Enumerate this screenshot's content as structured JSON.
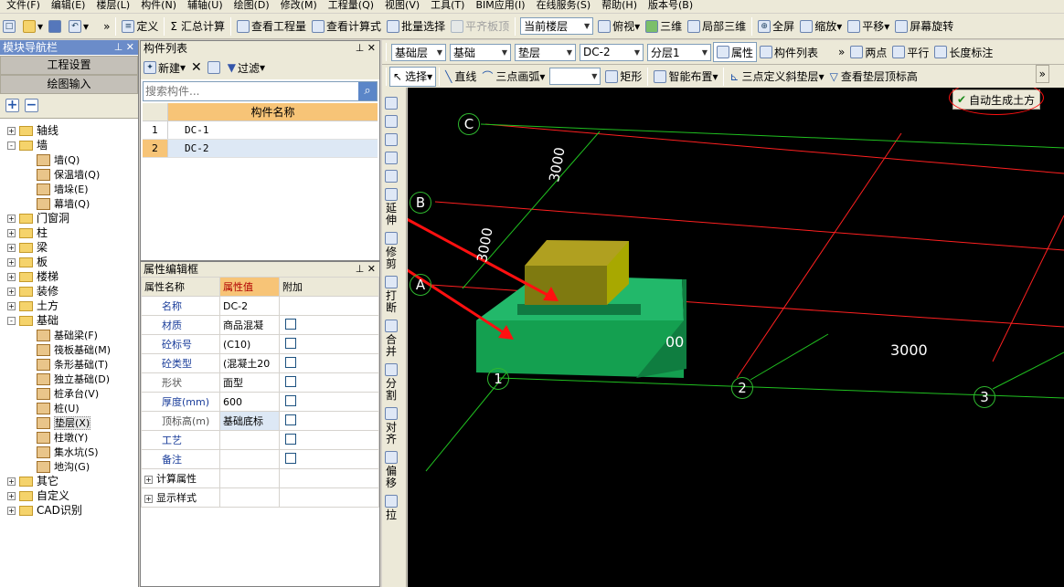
{
  "menu": [
    "文件(F)",
    "编辑(E)",
    "楼层(L)",
    "构件(N)",
    "辅轴(U)",
    "绘图(D)",
    "修改(M)",
    "工程量(Q)",
    "视图(V)",
    "工具(T)",
    "BIM应用(I)",
    "在线服务(S)",
    "帮助(H)",
    "版本号(B)"
  ],
  "toolbar1": {
    "more_left": "»",
    "define": "定义",
    "sum_calc": "汇总计算",
    "view_qty": "查看工程量",
    "view_formula": "查看计算式",
    "batch_select": "批量选择",
    "align_slab": "平齐板顶",
    "floor_select": "当前楼层",
    "top_view": "俯视",
    "three_d": "三维",
    "partial_3d": "局部三维",
    "full_screen": "全屏",
    "zoom": "缩放",
    "pan": "平移",
    "screen_rotate": "屏幕旋转"
  },
  "nav": {
    "title": "模块导航栏",
    "project_settings": "工程设置",
    "drawing_input": "绘图输入",
    "tree": [
      {
        "label": "轴线",
        "level": 0,
        "type": "folder",
        "exp": "+"
      },
      {
        "label": "墙",
        "level": 0,
        "type": "folder",
        "exp": "-"
      },
      {
        "label": "墙(Q)",
        "level": 1,
        "type": "leaf"
      },
      {
        "label": "保温墙(Q)",
        "level": 1,
        "type": "leaf"
      },
      {
        "label": "墙垛(E)",
        "level": 1,
        "type": "leaf"
      },
      {
        "label": "幕墙(Q)",
        "level": 1,
        "type": "leaf"
      },
      {
        "label": "门窗洞",
        "level": 0,
        "type": "folder",
        "exp": "+"
      },
      {
        "label": "柱",
        "level": 0,
        "type": "folder",
        "exp": "+"
      },
      {
        "label": "梁",
        "level": 0,
        "type": "folder",
        "exp": "+"
      },
      {
        "label": "板",
        "level": 0,
        "type": "folder",
        "exp": "+"
      },
      {
        "label": "楼梯",
        "level": 0,
        "type": "folder",
        "exp": "+"
      },
      {
        "label": "装修",
        "level": 0,
        "type": "folder",
        "exp": "+"
      },
      {
        "label": "土方",
        "level": 0,
        "type": "folder",
        "exp": "+"
      },
      {
        "label": "基础",
        "level": 0,
        "type": "folder",
        "exp": "-"
      },
      {
        "label": "基础梁(F)",
        "level": 1,
        "type": "leaf"
      },
      {
        "label": "筏板基础(M)",
        "level": 1,
        "type": "leaf"
      },
      {
        "label": "条形基础(T)",
        "level": 1,
        "type": "leaf"
      },
      {
        "label": "独立基础(D)",
        "level": 1,
        "type": "leaf"
      },
      {
        "label": "桩承台(V)",
        "level": 1,
        "type": "leaf"
      },
      {
        "label": "桩(U)",
        "level": 1,
        "type": "leaf"
      },
      {
        "label": "垫层(X)",
        "level": 1,
        "type": "leaf",
        "selected": true
      },
      {
        "label": "柱墩(Y)",
        "level": 1,
        "type": "leaf"
      },
      {
        "label": "集水坑(S)",
        "level": 1,
        "type": "leaf"
      },
      {
        "label": "地沟(G)",
        "level": 1,
        "type": "leaf"
      },
      {
        "label": "其它",
        "level": 0,
        "type": "folder",
        "exp": "+"
      },
      {
        "label": "自定义",
        "level": 0,
        "type": "folder",
        "exp": "+"
      },
      {
        "label": "CAD识别",
        "level": 0,
        "type": "folder",
        "exp": "+"
      }
    ]
  },
  "component_list": {
    "title": "构件列表",
    "new_btn": "新建",
    "filter_btn": "过滤",
    "search_placeholder": "搜索构件...",
    "col_name": "构件名称",
    "rows": [
      {
        "idx": "1",
        "name": "DC-1"
      },
      {
        "idx": "2",
        "name": "DC-2"
      }
    ]
  },
  "property_panel": {
    "title": "属性编辑框",
    "headers": [
      "属性名称",
      "属性值",
      "附加"
    ],
    "rows": [
      {
        "name": "名称",
        "value": "DC-2",
        "link": true,
        "check": false
      },
      {
        "name": "材质",
        "value": "商品混凝",
        "link": true,
        "check": true
      },
      {
        "name": "砼标号",
        "value": "(C10)",
        "link": true,
        "check": true
      },
      {
        "name": "砼类型",
        "value": "(混凝土20",
        "link": true,
        "check": true
      },
      {
        "name": "形状",
        "value": "面型",
        "link": false,
        "check": true
      },
      {
        "name": "厚度(mm)",
        "value": "600",
        "link": true,
        "check": true
      },
      {
        "name": "顶标高(m)",
        "value": "基础底标",
        "link": false,
        "check": true
      },
      {
        "name": "工艺",
        "value": "",
        "link": true,
        "check": true
      },
      {
        "name": "备注",
        "value": "",
        "link": true,
        "check": true
      }
    ],
    "groups": [
      "计算属性",
      "显示样式"
    ]
  },
  "toolbar2": {
    "layer_type": "基础层",
    "category": "基础",
    "component_type": "垫层",
    "component": "DC-2",
    "sublayer": "分层1",
    "attributes": "属性",
    "component_list": "构件列表",
    "two_points": "两点",
    "parallel": "平行",
    "length_dim": "长度标注"
  },
  "toolbar3": {
    "select": "选择",
    "line": "直线",
    "arc": "三点画弧",
    "rect": "矩形",
    "smart_place": "智能布置",
    "slope_define": "三点定义斜垫层",
    "view_top_elev": "查看垫层顶标高",
    "more": "»",
    "auto_earthwork": "自动生成土方"
  },
  "left_vertical_toolbar": [
    "延伸",
    "修剪",
    "打断",
    "合并",
    "分割",
    "对齐",
    "偏移",
    "拉"
  ],
  "canvas": {
    "axis_labels": [
      "C",
      "B",
      "A",
      "1",
      "2",
      "3"
    ],
    "dims": [
      "3000",
      "3000",
      "3000",
      "00"
    ]
  },
  "colors": {
    "canvas_bg": "#000000",
    "grid_red": "#ff2020",
    "grid_green": "#20c020",
    "slab_green": "#1ea05a",
    "column_olive": "#9a9a10",
    "arrow_red": "#ff1010",
    "panel_title": "#6b8cc9"
  }
}
